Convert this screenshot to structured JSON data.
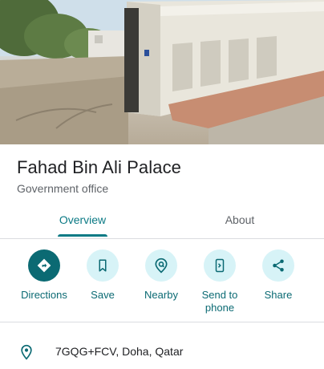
{
  "place": {
    "name": "Fahad Bin Ali Palace",
    "category": "Government office"
  },
  "tabs": [
    {
      "label": "Overview",
      "selected": true
    },
    {
      "label": "About",
      "selected": false
    }
  ],
  "actions": [
    {
      "label": "Directions",
      "icon": "directions-icon"
    },
    {
      "label": "Save",
      "icon": "bookmark-icon"
    },
    {
      "label": "Nearby",
      "icon": "nearby-icon"
    },
    {
      "label": "Send to phone",
      "icon": "send-to-phone-icon"
    },
    {
      "label": "Share",
      "icon": "share-icon"
    }
  ],
  "address": {
    "icon": "location-pin-icon",
    "text": "7GQG+FCV, Doha, Qatar"
  },
  "colors": {
    "accent": "#0b7a85",
    "action_bg": "#d7f3f7",
    "primary_action_bg": "#0b6a73"
  },
  "photo": {
    "subject": "street-view-photo"
  }
}
